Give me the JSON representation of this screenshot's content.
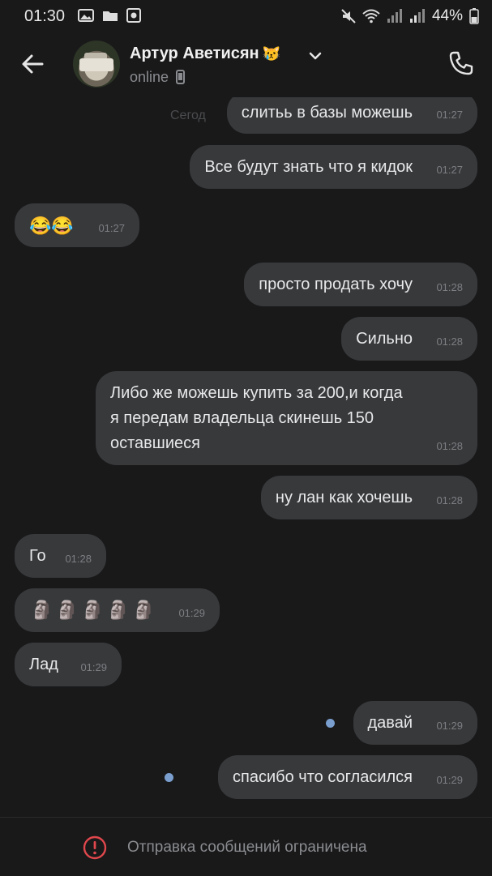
{
  "status_bar": {
    "time": "01:30",
    "battery": "44%"
  },
  "header": {
    "contact_name": "Артур Аветисян",
    "contact_emoji": "😿",
    "status": "online"
  },
  "chat": {
    "date_ghost": "Сегод",
    "messages": [
      {
        "id": "m1",
        "direction": "out",
        "text": "слитьь в базы можешь",
        "time": "01:27"
      },
      {
        "id": "m2",
        "direction": "out",
        "text": "Все будут знать что я кидок",
        "time": "01:27"
      },
      {
        "id": "m3",
        "direction": "in",
        "text": "😂😂",
        "time": "01:27"
      },
      {
        "id": "m4",
        "direction": "out",
        "text": "просто продать хочу",
        "time": "01:28"
      },
      {
        "id": "m5",
        "direction": "out",
        "text": "Сильно",
        "time": "01:28"
      },
      {
        "id": "m6",
        "direction": "out",
        "lines": [
          "Либо же можешь купить за 200,и когда",
          "я передам владельца скинешь 150",
          "оставшиеся"
        ],
        "time": "01:28"
      },
      {
        "id": "m7",
        "direction": "out",
        "text": "ну лан как хочешь",
        "time": "01:28"
      },
      {
        "id": "m8",
        "direction": "in",
        "text": "Го",
        "time": "01:28"
      },
      {
        "id": "m9",
        "direction": "in",
        "text": "🗿🗿🗿🗿🗿",
        "time": "01:29"
      },
      {
        "id": "m10",
        "direction": "in",
        "text": "Лад",
        "time": "01:29"
      },
      {
        "id": "m11",
        "direction": "out",
        "text": "давай",
        "time": "01:29",
        "unread": true
      },
      {
        "id": "m12",
        "direction": "out",
        "text": "спасибо что согласился",
        "time": "01:29",
        "unread": true
      }
    ]
  },
  "footer": {
    "restriction_text": "Отправка сообщений ограничена"
  },
  "colors": {
    "background": "#19191a",
    "bubble": "#37393b",
    "unread_dot": "#7a9fcf",
    "restriction_icon": "#e0474c"
  },
  "icons": [
    "back-arrow-icon",
    "chevron-down-icon",
    "phone-call-icon",
    "mobile-phone-icon",
    "warning-circle-icon"
  ]
}
